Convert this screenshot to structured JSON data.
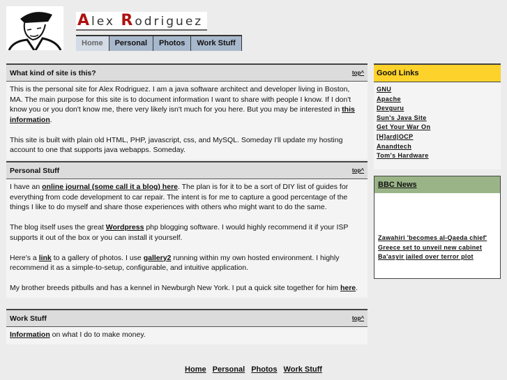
{
  "header": {
    "logo_text": "Alex Rodriguez",
    "logo_first": "A",
    "logo_first_rest": "lex ",
    "logo_last": "R",
    "logo_last_rest": "odriguez"
  },
  "nav": [
    "Home",
    "Personal",
    "Photos",
    "Work Stuff"
  ],
  "top_label": "top^",
  "sections": [
    {
      "title": "What kind of site is this?",
      "p1a": "This is the personal site for Alex Rodriguez. I am a java software architect and developer living in Boston, MA. The main purpose for this site is to document information I want to share with people I know. If I don't know you or you don't know me, there very likely isn't much for you here. But you may be interested in ",
      "p1link": "this information",
      "p1b": ".",
      "p2": "This site is built with plain old HTML, PHP, javascript, css, and MySQL. Someday I'll update my hosting account to one that supports java webapps. Someday."
    },
    {
      "title": "Personal Stuff",
      "p1a": "I have an ",
      "p1link": "online journal (some call it a blog) here",
      "p1b": ". The plan is for it to be a sort of DIY list of guides for everything from code development to car repair. The intent is for me to capture a good percentage of the things I like to do myself and share those experiences with others who might want to do the same.",
      "p2a": "The blog itself uses the great ",
      "p2link": "Wordpress",
      "p2b": " php blogging software. I would highly recommend it if your ISP supports it out of the box or you can install it yourself.",
      "p3a": "Here's a ",
      "p3link": "link",
      "p3b": " to a gallery of photos. I use ",
      "p3link2": "gallery2",
      "p3c": " running within my own hosted environment. I highly recommend it as a simple-to-setup, configurable, and intuitive application.",
      "p4a": "My brother breeds pitbulls and has a kennel in Newburgh New York. I put a quick site together for him ",
      "p4link": "here",
      "p4b": "."
    },
    {
      "title": "Work Stuff",
      "p1link": "Information",
      "p1b": " on what I do to make money."
    }
  ],
  "good_links": {
    "title": "Good Links",
    "items": [
      "GNU",
      "Apache",
      "Devguru",
      "Sun's Java Site",
      "Get Your War On",
      "[H]ard|OCP",
      "Anandtech",
      "Tom's Hardware"
    ]
  },
  "bbc": {
    "title": "BBC News",
    "items": [
      "Zawahiri 'becomes al-Qaeda chief'",
      "Greece set to unveil new cabinet",
      "Ba'asyir jailed over terror plot"
    ]
  },
  "footer": [
    "Home",
    "Personal",
    "Photos",
    "Work Stuff"
  ]
}
